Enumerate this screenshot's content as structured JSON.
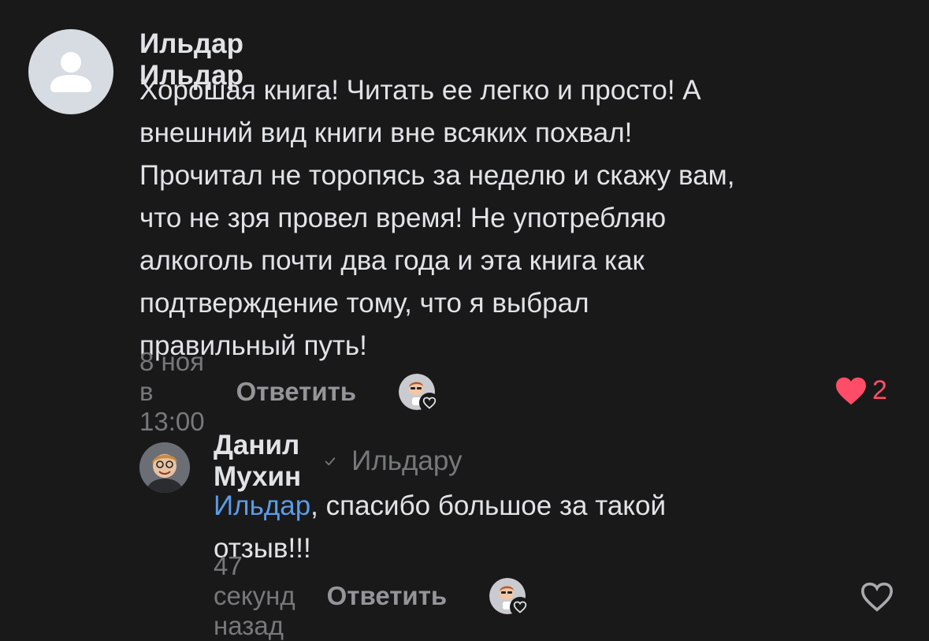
{
  "comment": {
    "author": "Ильдар Ильдар",
    "text": "Хорошая книга! Читать ее легко и просто! А\nвнешний вид книги вне всяких похвал!\nПрочитал не торопясь за неделю и скажу вам,\nчто не зря провел время! Не употребляю\nалкоголь почти два года и эта книга как\nподтверждение тому, что я выбрал\nправильный путь!",
    "time": "8 ноя в 13:00",
    "reply_label": "Ответить",
    "likes": "2",
    "liked": true
  },
  "reply": {
    "author": "Данил Мухин",
    "reply_to": "Ильдару",
    "mention": "Ильдар",
    "text_rest": ", спасибо большое за такой\nотзыв!!!",
    "time": "47 секунд назад",
    "reply_label": "Ответить",
    "liked": false
  },
  "colors": {
    "background": "#19191a",
    "text": "#e1e3e6",
    "secondary": "#76787a",
    "accent_link": "#5c9ce6",
    "like": "#ff4d67"
  }
}
